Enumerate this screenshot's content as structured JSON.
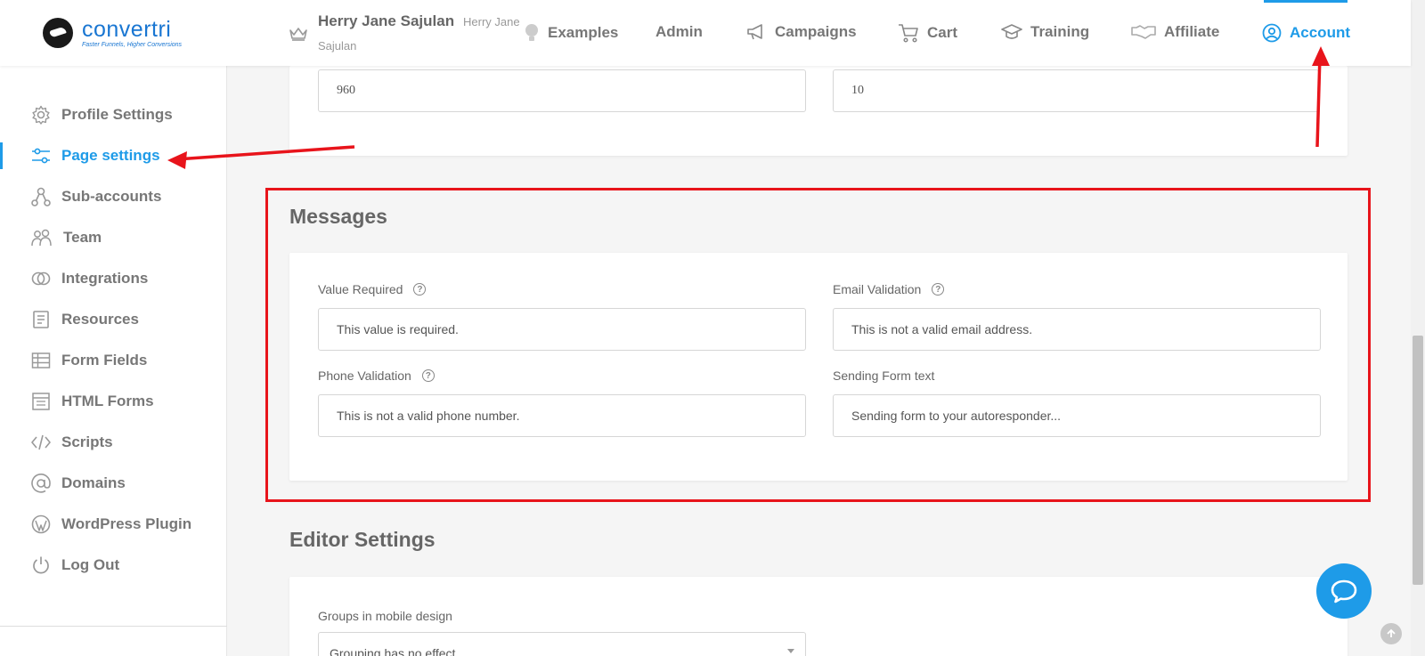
{
  "header": {
    "logo_name": "convertri",
    "logo_tagline": "Faster Funnels, Higher Conversions",
    "user_name": "Herry Jane Sajulan",
    "user_sub_line1": "Herry Jane",
    "user_sub_line2": "Sajulan",
    "nav": [
      {
        "label": "Examples",
        "icon": "lightbulb-icon"
      },
      {
        "label": "Admin",
        "icon": ""
      },
      {
        "label": "Campaigns",
        "icon": "megaphone-icon"
      },
      {
        "label": "Cart",
        "icon": "cart-icon"
      },
      {
        "label": "Training",
        "icon": "graduation-cap-icon"
      },
      {
        "label": "Affiliate",
        "icon": "handshake-icon"
      },
      {
        "label": "Account",
        "icon": "user-circle-icon",
        "active": true
      }
    ]
  },
  "sidebar": {
    "items": [
      {
        "label": "Profile Settings",
        "icon": "gear-icon"
      },
      {
        "label": "Page settings",
        "icon": "sliders-icon",
        "active": true
      },
      {
        "label": "Sub-accounts",
        "icon": "network-icon"
      },
      {
        "label": "Team",
        "icon": "team-icon"
      },
      {
        "label": "Integrations",
        "icon": "link-icon"
      },
      {
        "label": "Resources",
        "icon": "book-icon"
      },
      {
        "label": "Form Fields",
        "icon": "table-icon"
      },
      {
        "label": "HTML Forms",
        "icon": "form-icon"
      },
      {
        "label": "Scripts",
        "icon": "code-icon"
      },
      {
        "label": "Domains",
        "icon": "at-icon"
      },
      {
        "label": "WordPress Plugin",
        "icon": "wordpress-icon"
      },
      {
        "label": "Log Out",
        "icon": "power-icon"
      }
    ]
  },
  "top_card": {
    "field_left_value": "960",
    "field_right_value": "10"
  },
  "messages": {
    "title": "Messages",
    "value_required_label": "Value Required",
    "value_required_value": "This value is required.",
    "email_validation_label": "Email Validation",
    "email_validation_value": "This is not a valid email address.",
    "phone_validation_label": "Phone Validation",
    "phone_validation_value": "This is not a valid phone number.",
    "sending_form_label": "Sending Form text",
    "sending_form_value": "Sending form to your autoresponder..."
  },
  "editor_settings": {
    "title": "Editor Settings",
    "groups_label": "Groups in mobile design",
    "groups_value": "Grouping has no effect"
  },
  "colors": {
    "accent": "#1e9be8",
    "highlight": "#e8141b"
  }
}
